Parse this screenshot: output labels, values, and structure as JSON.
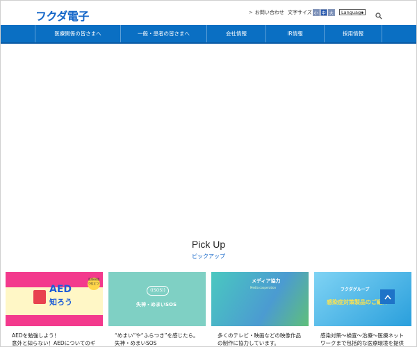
{
  "header": {
    "logo": "フクダ電子",
    "contact_label": "お問い合わせ",
    "font_size_label": "文字サイズ",
    "font_size_options": [
      "小",
      "中",
      "大"
    ],
    "language_label": "Language"
  },
  "nav": {
    "items": [
      {
        "label": "医療関係の皆さまへ"
      },
      {
        "label": "一般・患者の皆さまへ"
      },
      {
        "label": "会社情報"
      },
      {
        "label": "IR情報"
      },
      {
        "label": "採用情報"
      }
    ]
  },
  "pickup": {
    "title": "Pick Up",
    "subtitle": "ピックアップ",
    "cards": [
      {
        "thumb": {
          "main": "AED",
          "sub": "知ろう",
          "badge": "医療現場で役立つ!"
        },
        "line1": "AEDを勉強しよう！",
        "line2": "意外と知らない！AEDについてのギ"
      },
      {
        "thumb": {
          "main": "((SOS))",
          "sub": "失神・めまいSOS"
        },
        "line1": "“めまい”や“ふらつき”を感じたら。",
        "line2": "失神・めまいSOS"
      },
      {
        "thumb": {
          "main": "メディア協力",
          "sub": "Media cooperation"
        },
        "line1": "多くのテレビ・映画などの映像作品",
        "line2": "の制作に協力しています。"
      },
      {
        "thumb": {
          "main": "フクダグループ",
          "sub": "感染症対策製品のご紹介"
        },
        "line1": "感染対策～検査～治療～医療ネット",
        "line2": "ワークまで包括的な医療環境を提供"
      }
    ]
  },
  "colors": {
    "brand_blue": "#0a6fc3",
    "logo_blue": "#1466c8",
    "accent_orange": "#f0a020"
  },
  "icons": {
    "search": "search-icon",
    "scroll_top": "chevron-up-icon"
  }
}
